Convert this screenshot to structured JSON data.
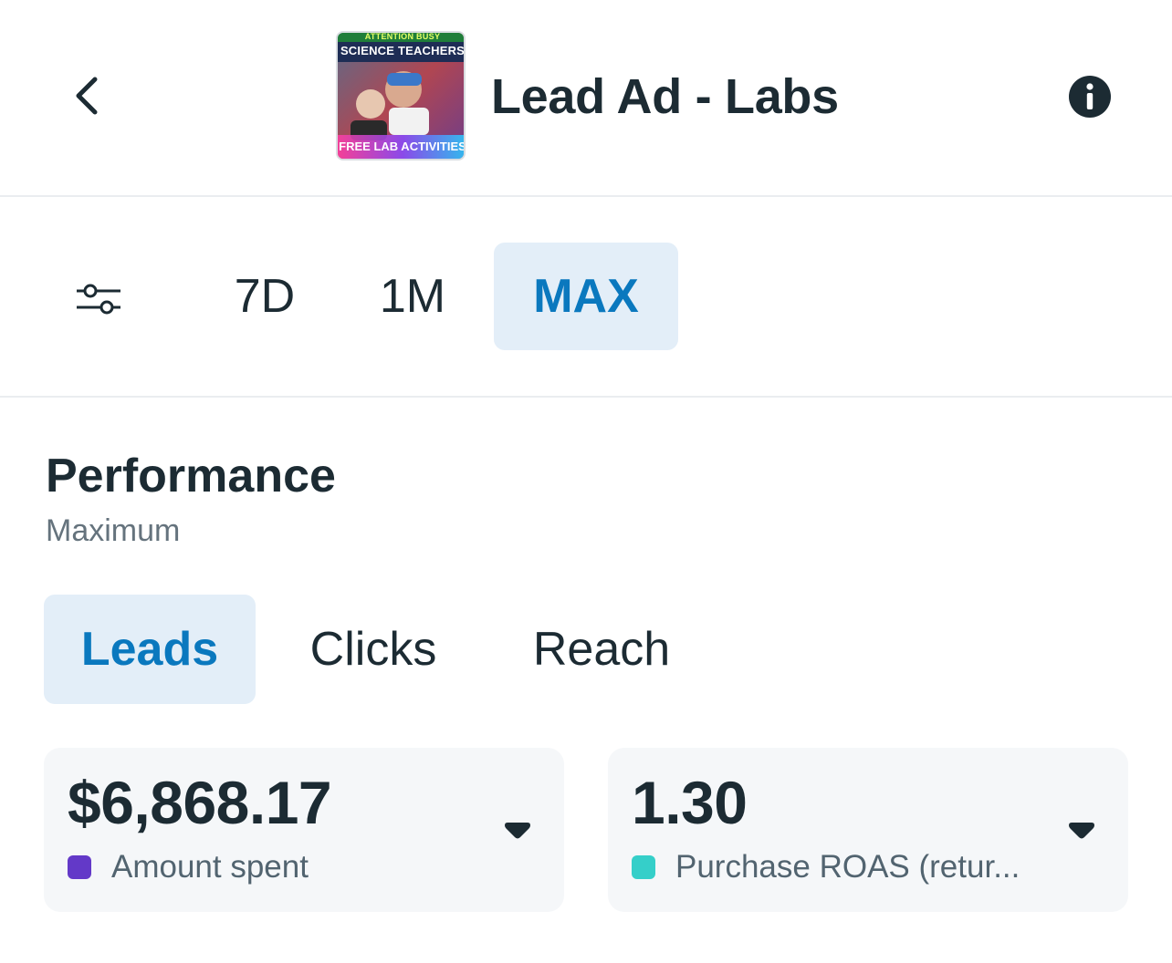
{
  "header": {
    "title": "Lead Ad - Labs",
    "thumbnail": {
      "line1": "ATTENTION BUSY",
      "line2": "SCIENCE TEACHERS",
      "line3": "FREE LAB ACTIVITIES"
    },
    "back_icon": "chevron-left-icon",
    "info_icon": "info-icon"
  },
  "range": {
    "filter_icon": "sliders-icon",
    "tabs": [
      {
        "label": "7D",
        "selected": false
      },
      {
        "label": "1M",
        "selected": false
      },
      {
        "label": "MAX",
        "selected": true
      }
    ]
  },
  "performance": {
    "title": "Performance",
    "subtitle": "Maximum",
    "tabs": [
      {
        "label": "Leads",
        "selected": true
      },
      {
        "label": "Clicks",
        "selected": false
      },
      {
        "label": "Reach",
        "selected": false
      }
    ],
    "cards": [
      {
        "value": "$6,868.17",
        "label": "Amount spent",
        "color": "#6339c8"
      },
      {
        "value": "1.30",
        "label": "Purchase ROAS (retur...",
        "color": "#35cfc9"
      }
    ]
  },
  "colors": {
    "accent": "#0a78be",
    "selected_bg": "#e3eef8",
    "text": "#1c2b33"
  }
}
